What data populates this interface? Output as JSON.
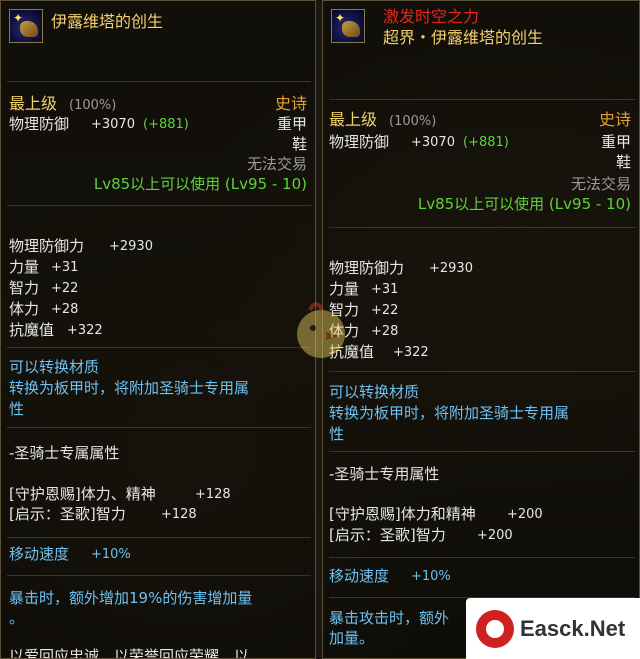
{
  "left": {
    "title": "伊露维塔的创生",
    "grade_label": "最上级",
    "grade_pct": "(100%)",
    "rarity": "史诗",
    "phys_def_label": "物理防御",
    "phys_def_val": "+3070",
    "phys_def_bonus": "(+881)",
    "armor_type": "重甲",
    "slot": "鞋",
    "trade": "无法交易",
    "level_req": "Lv85以上可以使用 (Lv95 - 10)",
    "stats": [
      {
        "label": "物理防御力",
        "value": "+2930"
      },
      {
        "label": "力量",
        "value": "+31"
      },
      {
        "label": "智力",
        "value": "+22"
      },
      {
        "label": "体力",
        "value": "+28"
      },
      {
        "label": "抗魔值",
        "value": "+322"
      }
    ],
    "convert_1": "可以转换材质",
    "convert_2": "转换为板甲时，将附加圣骑士专用属",
    "convert_3": "性",
    "class_header": "-圣骑士专属属性",
    "skill_1": "[守护恩赐]体力、精神",
    "skill_1_val": "+128",
    "skill_2": "[启示：圣歌]智力",
    "skill_2_val": "+128",
    "move_speed_label": "移动速度",
    "move_speed_val": "+10%",
    "crit_1": "暴击时，额外增加19%的伤害增加量",
    "crit_2": "。",
    "bottom_text": "以爱回应忠诚，以荣誉回应荣耀，以"
  },
  "right": {
    "subtitle": "激发时空之力",
    "title": "超界・伊露维塔的创生",
    "grade_label": "最上级",
    "grade_pct": "(100%)",
    "rarity": "史诗",
    "phys_def_label": "物理防御",
    "phys_def_val": "+3070",
    "phys_def_bonus": "(+881)",
    "armor_type": "重甲",
    "slot": "鞋",
    "trade": "无法交易",
    "level_req": "Lv85以上可以使用 (Lv95 - 10)",
    "stats": [
      {
        "label": "物理防御力",
        "value": "+2930"
      },
      {
        "label": "力量",
        "value": "+31"
      },
      {
        "label": "智力",
        "value": "+22"
      },
      {
        "label": "体力",
        "value": "+28"
      },
      {
        "label": "抗魔值",
        "value": "+322"
      }
    ],
    "convert_1": "可以转换材质",
    "convert_2": "转换为板甲时，将附加圣骑士专用属",
    "convert_3": "性",
    "class_header": "-圣骑士专用属性",
    "skill_1": "[守护恩赐]体力和精神",
    "skill_1_val": "+200",
    "skill_2": "[启示：圣歌]智力",
    "skill_2_val": "+200",
    "move_speed_label": "移动速度",
    "move_speed_val": "+10%",
    "crit_1": "暴击攻击时，额外",
    "crit_2": "加量。"
  },
  "watermark": {
    "brand": "Easck.Net"
  },
  "colors": {
    "rarity": "#e8a030",
    "grade": "#f4d06a",
    "level_req": "#5fd23a",
    "bonus": "#5fd23a",
    "special": "#6ec0f0",
    "awaken": "#e8241c"
  },
  "icons": [
    "shoe-item-icon",
    "star-icon",
    "mascot-chick-icon",
    "easck-logo-icon"
  ]
}
